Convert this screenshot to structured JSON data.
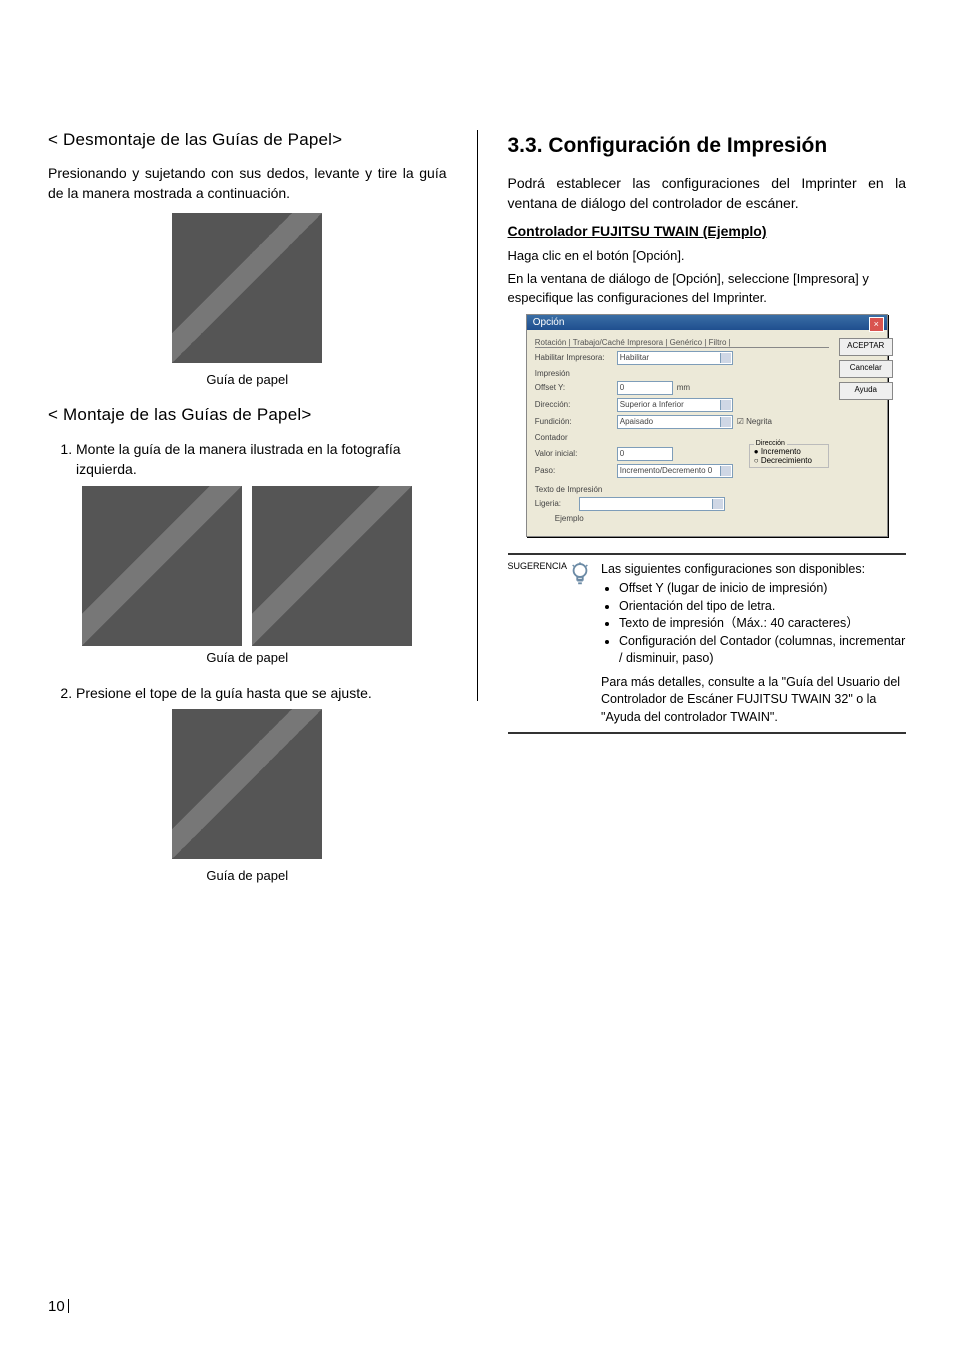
{
  "left": {
    "heading1": "< Desmontaje de las Guías de Papel>",
    "para1": "Presionando y sujetando con sus dedos, levante y tire la guía de la manera mostrada a continuación.",
    "caption1": "Guía de papel",
    "heading2": "< Montaje de las Guías de Papel>",
    "step1": "Monte la guía de la manera ilustrada en la fotografía izquierda.",
    "caption2": "Guía de papel",
    "step2": "Presione el tope de la guía hasta que se ajuste.",
    "caption3": "Guía de papel"
  },
  "right": {
    "sectionTitle": "3.3. Configuración de Impresión",
    "intro": "Podrá establecer las configuraciones del Imprinter en la ventana de diálogo del controlador de escáner.",
    "subHeading": "Controlador FUJITSU TWAIN (Ejemplo)",
    "p1": "Haga clic en el botón [Opción].",
    "p2": "En la ventana de diálogo de [Opción], seleccione [Impresora] y especifique las configuraciones del Imprinter.",
    "tipLabel": "SUGERENCIA",
    "tipIntro": "Las siguientes configuraciones son disponibles:",
    "tipBullet1": "Offset Y (lugar de inicio de impresión)",
    "tipBullet2": "Orientación del tipo de letra.",
    "tipBullet3": "Texto de impresión（Máx.: 40 caracteres）",
    "tipBullet4": "Configuración del Contador (columnas, incrementar / disminuir, paso)",
    "tipFooter": "Para más detalles, consulte a la \"Guía del Usuario del Controlador de Escáner FUJITSU TWAIN 32\" o la \"Ayuda del controlador TWAIN\"."
  },
  "dialog": {
    "title": "Opción",
    "tabs": "Rotación | Trabajo/Caché   Impresora | Genérico | Filtro |",
    "rows": {
      "enableLabel": "Habilitar Impresora:",
      "enableValue": "Habilitar",
      "impresion": "Impresión",
      "offsetLabel": "Offset Y:",
      "offsetValue": "0",
      "offsetUnit": "mm",
      "dirLabel": "Dirección:",
      "dirValue": "Superior a Inferior",
      "fontLabel": "Fundición:",
      "fontValue": "Apaisado",
      "negrita": "Negrita",
      "contador": "Contador",
      "valorLabel": "Valor inicial:",
      "valorValue": "0",
      "pasoLabel": "Paso:",
      "pasoValue": "Incremento/Decremento 0",
      "direccionGroup": "Dirección",
      "incremento": "Incremento",
      "decrecimiento": "Decrecimiento",
      "textoSection": "Texto de Impresión",
      "ligeriaLabel": "Ligeria:",
      "ejemplo": "Ejemplo"
    },
    "buttons": {
      "aceptar": "ACEPTAR",
      "cancelar": "Cancelar",
      "ayuda": "Ayuda"
    }
  },
  "pageNumber": "10"
}
